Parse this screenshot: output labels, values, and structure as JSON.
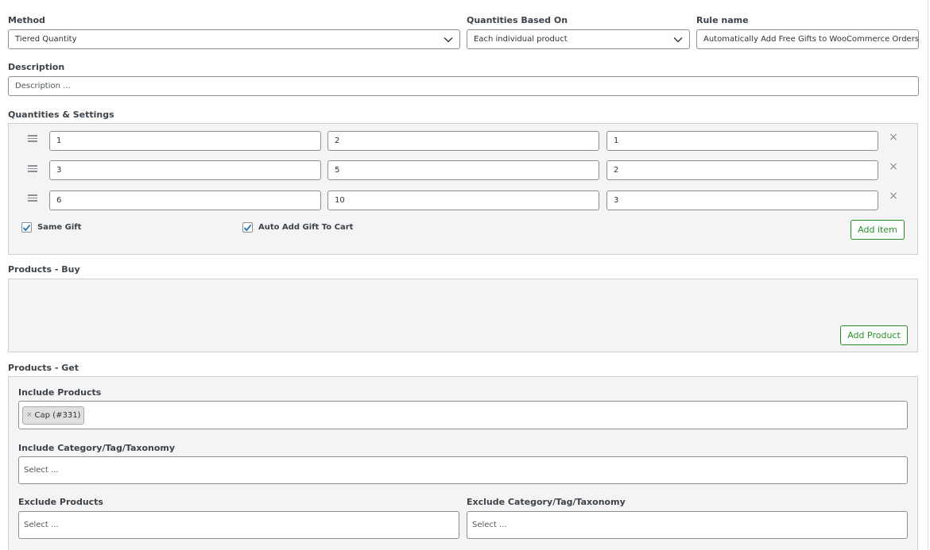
{
  "method": {
    "label": "Method",
    "value": "Tiered Quantity",
    "icon": "chevron-down-icon"
  },
  "quantities_based_on": {
    "label": "Quantities Based On",
    "value": "Each individual product",
    "icon": "chevron-down-icon"
  },
  "rule_name": {
    "label": "Rule name",
    "value": "Automatically Add Free Gifts to WooCommerce Orders"
  },
  "description": {
    "label": "Description",
    "placeholder": "Description ..."
  },
  "quantities_settings": {
    "label": "Quantities & Settings",
    "rows": [
      {
        "from": "1",
        "to": "2",
        "gift_qty": "1"
      },
      {
        "from": "3",
        "to": "5",
        "gift_qty": "2"
      },
      {
        "from": "6",
        "to": "10",
        "gift_qty": "3"
      }
    ],
    "remove_icon": "×",
    "same_gift": {
      "label": "Same Gift",
      "checked": true
    },
    "auto_add": {
      "label": "Auto Add Gift To Cart",
      "checked": true
    },
    "add_item_label": "Add item"
  },
  "products_buy": {
    "label": "Products - Buy",
    "add_product_label": "Add Product"
  },
  "products_get": {
    "label": "Products - Get",
    "include_products": {
      "label": "Include Products",
      "tags": [
        {
          "remove": "×",
          "text": "Cap (#331)"
        }
      ]
    },
    "include_category": {
      "label": "Include Category/Tag/Taxonomy",
      "placeholder": "Select ..."
    },
    "exclude_products": {
      "label": "Exclude Products",
      "placeholder": "Select ..."
    },
    "exclude_category": {
      "label": "Exclude Category/Tag/Taxonomy",
      "placeholder": "Select ..."
    }
  },
  "colors": {
    "accent_green": "#2a8f2a",
    "checkbox_blue": "#2271b1",
    "panel_bg": "#f4f4f4",
    "border": "#8c8f94"
  }
}
